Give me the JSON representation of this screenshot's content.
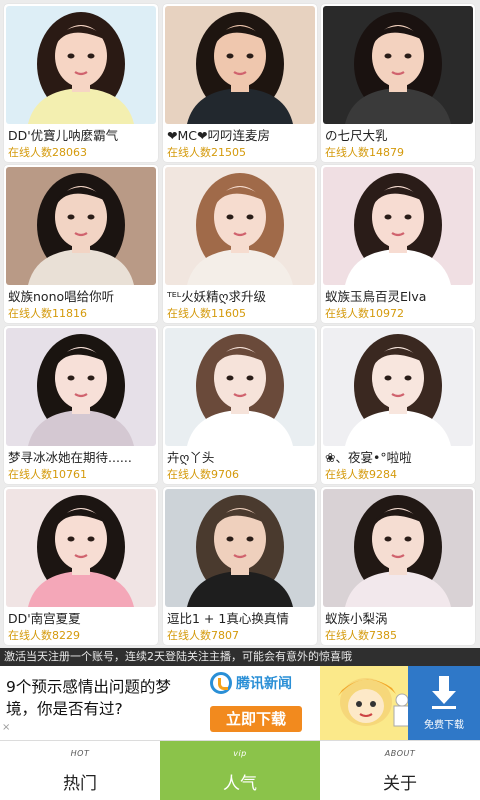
{
  "streamers": [
    {
      "name": "DD'优寶儿呐麼霸气",
      "count_label": "在线人数28063",
      "palette": {
        "bg": "#ddeef6",
        "hair": "#2a1a14",
        "skin": "#f6d5c4",
        "cloth": "#f3efb0"
      }
    },
    {
      "name": "❤MC❤叼叼连麦房",
      "count_label": "在线人数21505",
      "palette": {
        "bg": "#e7d2c0",
        "hair": "#1e1510",
        "skin": "#efc7ae",
        "cloth": "#22282e"
      }
    },
    {
      "name": "の七尺大乳",
      "count_label": "在线人数14879",
      "palette": {
        "bg": "#2a2a2a",
        "hair": "#1a1210",
        "skin": "#f3d2bf",
        "cloth": "#3a3a3a"
      }
    },
    {
      "name": "蚁族nono唱给你听",
      "count_label": "在线人数11816",
      "palette": {
        "bg": "#b99a86",
        "hair": "#1b1411",
        "skin": "#f2d4c4",
        "cloth": "#e9e0d6"
      }
    },
    {
      "name": "ᵀᴱᴸ火妖精ღ求升级",
      "count_label": "在线人数11605",
      "palette": {
        "bg": "#f1e6df",
        "hair": "#a06a49",
        "skin": "#f6dccf",
        "cloth": "#f4eee8"
      }
    },
    {
      "name": "蚁族玉鳥百灵Elva",
      "count_label": "在线人数10972",
      "palette": {
        "bg": "#f0dfe3",
        "hair": "#2a1c18",
        "skin": "#f7dcd2",
        "cloth": "#ffffff"
      }
    },
    {
      "name": "梦寻冰冰她在期待......",
      "count_label": "在线人数10761",
      "palette": {
        "bg": "#e6e0e8",
        "hair": "#1a1410",
        "skin": "#f7e0d8",
        "cloth": "#d4c8d2"
      }
    },
    {
      "name": "卉ღ丫头",
      "count_label": "在线人数9706",
      "palette": {
        "bg": "#e9eef1",
        "hair": "#6a4a3a",
        "skin": "#f6e3da",
        "cloth": "#ffffff"
      }
    },
    {
      "name": "❀、夜宴•°啦啦",
      "count_label": "在线人数9284",
      "palette": {
        "bg": "#efeff2",
        "hair": "#3a2820",
        "skin": "#f8e6de",
        "cloth": "#ffffff"
      }
    },
    {
      "name": "DD'南宫夏夏",
      "count_label": "在线人数8229",
      "palette": {
        "bg": "#f0e4e4",
        "hair": "#1c1512",
        "skin": "#f7ddd3",
        "cloth": "#f4a7b8"
      }
    },
    {
      "name": "逗比1 + 1真心换真情",
      "count_label": "在线人数7807",
      "palette": {
        "bg": "#cdd3d8",
        "hair": "#4a3a2e",
        "skin": "#efd0bd",
        "cloth": "#1e1e1e"
      }
    },
    {
      "name": "蚁族小梨涡",
      "count_label": "在线人数7385",
      "palette": {
        "bg": "#d9d2d5",
        "hair": "#211814",
        "skin": "#f5ddd2",
        "cloth": "#f2e8ec"
      }
    }
  ],
  "marquee": {
    "text": "激活当天注册一个账号，连续2天登陆关注主播，可能会有意外的惊喜哦"
  },
  "ad": {
    "headline": "9个预示感情出问题的梦境，你是否有过?",
    "brand": "腾讯新闻",
    "download_label": "立即下载",
    "free_label": "免费下载"
  },
  "tabs": [
    {
      "sub": "HOT",
      "label": "热门",
      "active": false
    },
    {
      "sub": "vip",
      "label": "人气",
      "active": true
    },
    {
      "sub": "ABOUT",
      "label": "关于",
      "active": false
    }
  ],
  "colors": {
    "count_text": "#d49a0c",
    "active_tab": "#8bc34a",
    "marquee_bg": "#2f2f2f",
    "download_button": "#f28a1e",
    "free_download_bg": "#2f78c8"
  }
}
